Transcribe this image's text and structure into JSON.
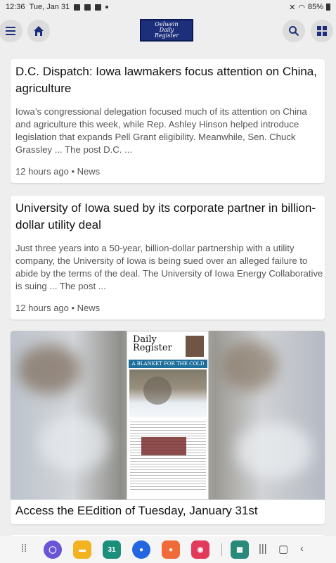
{
  "status_bar": {
    "time": "12:36",
    "date": "Tue, Jan 31",
    "battery": "85%"
  },
  "header": {
    "logo_line1": "Oelwein",
    "logo_line2": "Daily",
    "logo_line3": "Register"
  },
  "icons": {
    "menu": "hamburger-icon",
    "home": "home-icon",
    "search": "search-icon",
    "grid": "grid-icon"
  },
  "articles": [
    {
      "title": "D.C. Dispatch: Iowa lawmakers focus attention on China, agriculture",
      "excerpt": "Iowa’s congressional delegation focused much of its attention on China and agriculture this week, while Rep. Ashley Hinson helped introduce legislation that expands Pell Grant eligibility. Meanwhile, Sen. Chuck Grassley ... The post D.C. ...",
      "meta": "12 hours ago • News"
    },
    {
      "title": "University of Iowa sued by its corporate partner in billion-dollar utility deal",
      "excerpt": "Just three years into a 50-year, billion-dollar partnership with a utility company, the University of Iowa is being sued over an alleged failure to abide by the terms of the deal. The University of Iowa Energy Collaborative is suing ... The post ...",
      "meta": "12 hours ago • News"
    }
  ],
  "eedition": {
    "caption": "Access the EEdition of Tuesday, January 31st",
    "paper_masthead": "Daily Register",
    "paper_headline": "A BLANKET FOR THE COLD"
  },
  "dock": {
    "calendar_day": "31"
  },
  "colors": {
    "brand": "#1d2f7a",
    "background": "#eeeeee"
  }
}
